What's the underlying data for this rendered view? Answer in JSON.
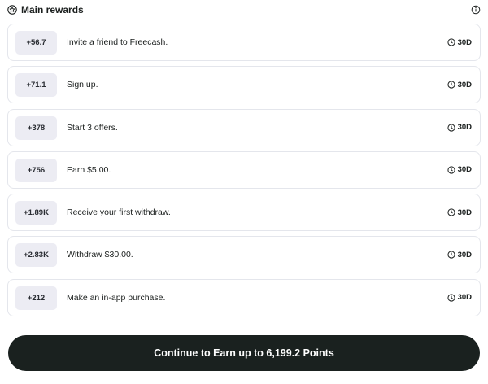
{
  "header": {
    "title": "Main rewards",
    "left_icon": "star-circle-icon",
    "right_icon": "info-icon"
  },
  "rewards": [
    {
      "points": "+56.7",
      "description": "Invite a friend to Freecash.",
      "duration": "30D"
    },
    {
      "points": "+71.1",
      "description": "Sign up.",
      "duration": "30D"
    },
    {
      "points": "+378",
      "description": "Start 3 offers.",
      "duration": "30D"
    },
    {
      "points": "+756",
      "description": "Earn $5.00.",
      "duration": "30D"
    },
    {
      "points": "+1.89K",
      "description": "Receive your first withdraw.",
      "duration": "30D"
    },
    {
      "points": "+2.83K",
      "description": "Withdraw $30.00.",
      "duration": "30D"
    },
    {
      "points": "+212",
      "description": "Make an in-app purchase.",
      "duration": "30D"
    }
  ],
  "cta": {
    "label": "Continue to Earn up to 6,199.2 Points"
  },
  "colors": {
    "badge_bg": "#ececf3",
    "card_border": "#e4e6ec",
    "cta_bg": "#1a211f",
    "text": "#1b1f1e"
  }
}
